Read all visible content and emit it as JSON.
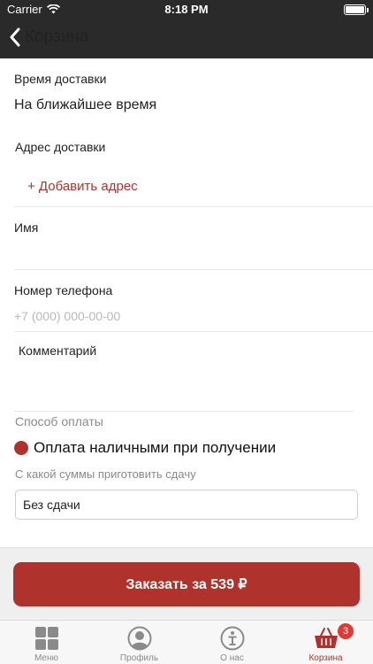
{
  "status_bar": {
    "carrier": "Carrier",
    "time": "8:18 PM"
  },
  "nav": {
    "title": "Корзина"
  },
  "form": {
    "delivery_time": {
      "label": "Время доставки",
      "value": "На ближайшее время"
    },
    "address": {
      "label": "Адрес доставки",
      "add_label": "+ Добавить адрес"
    },
    "name": {
      "label": "Имя",
      "value": ""
    },
    "phone": {
      "label": "Номер телефона",
      "placeholder": "+7 (000) 000-00-00"
    },
    "comment": {
      "label": "Комментарий",
      "value": ""
    }
  },
  "payment": {
    "title": "Способ оплаты",
    "selected_option": "Оплата наличными при получении",
    "change_hint": "С какой суммы приготовить сдачу",
    "change_value": "Без сдачи"
  },
  "order_button": {
    "label": "Заказать за 539 ₽"
  },
  "tab_bar": {
    "tabs": [
      {
        "label": "Меню",
        "icon": "grid-icon"
      },
      {
        "label": "Профиль",
        "icon": "profile-icon"
      },
      {
        "label": "О нас",
        "icon": "info-icon"
      },
      {
        "label": "Корзина",
        "icon": "basket-icon",
        "badge": "3"
      }
    ]
  },
  "colors": {
    "accent": "#b0322c",
    "header": "#2a2a2a",
    "badge": "#e03a36"
  }
}
